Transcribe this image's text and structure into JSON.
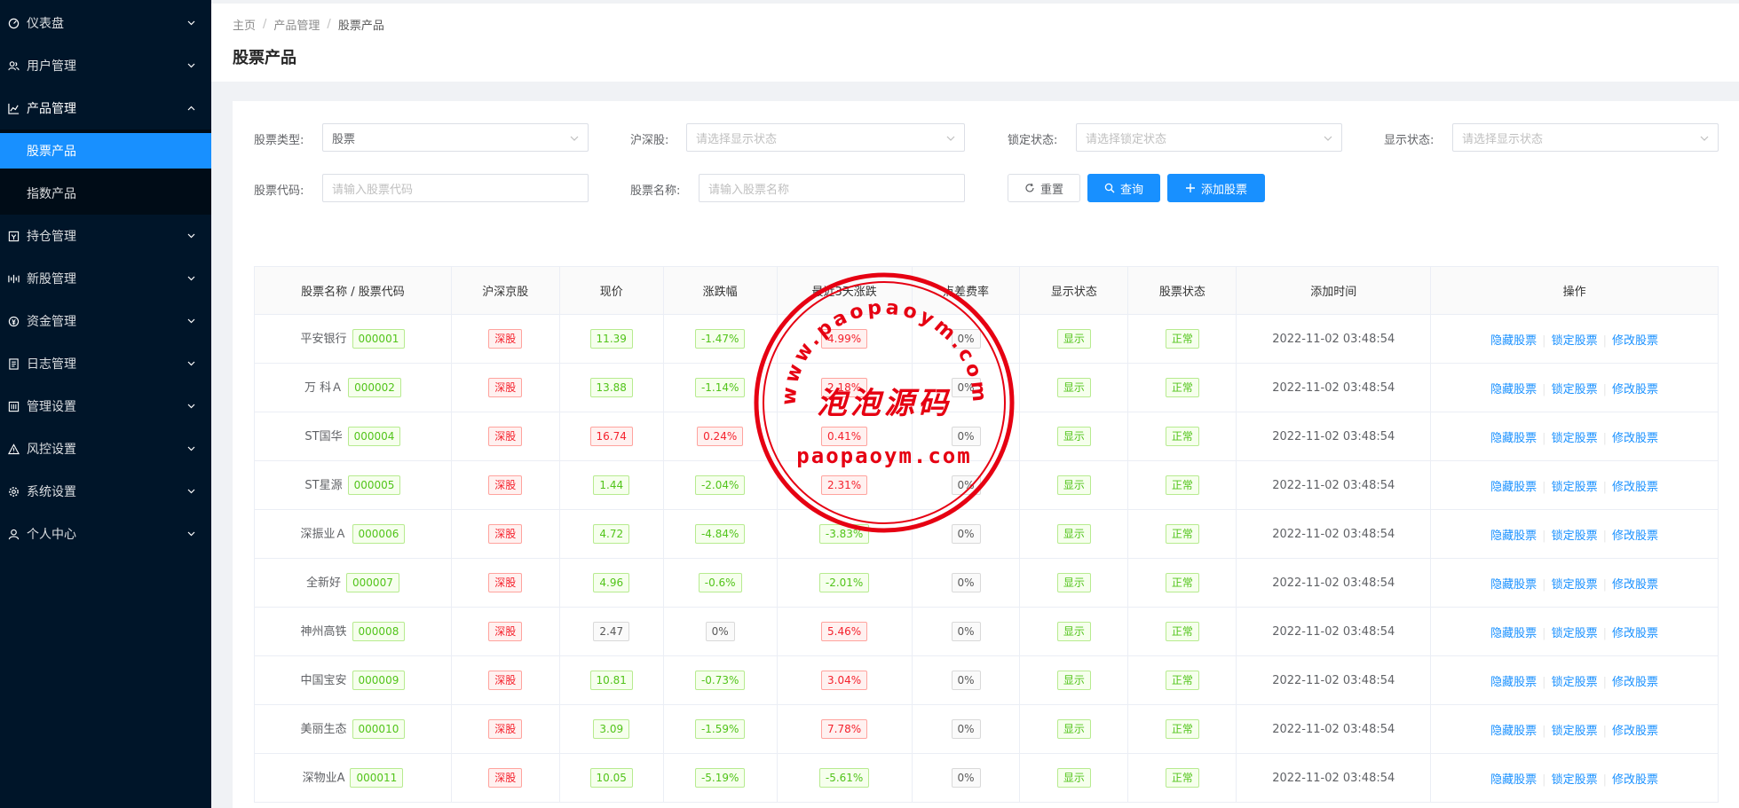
{
  "sidebar": {
    "items": [
      {
        "label": "仪表盘",
        "icon": "dashboard-icon"
      },
      {
        "label": "用户管理",
        "icon": "user-group-icon"
      },
      {
        "label": "产品管理",
        "icon": "chart-icon"
      },
      {
        "label": "持仓管理",
        "icon": "position-icon"
      },
      {
        "label": "新股管理",
        "icon": "ipo-icon"
      },
      {
        "label": "资金管理",
        "icon": "money-icon"
      },
      {
        "label": "日志管理",
        "icon": "log-icon"
      },
      {
        "label": "管理设置",
        "icon": "admin-settings-icon"
      },
      {
        "label": "风控设置",
        "icon": "warning-icon"
      },
      {
        "label": "系统设置",
        "icon": "gear-icon"
      },
      {
        "label": "个人中心",
        "icon": "person-icon"
      }
    ],
    "sub_items": [
      {
        "label": "股票产品"
      },
      {
        "label": "指数产品"
      }
    ]
  },
  "breadcrumb": {
    "home": "主页",
    "parent": "产品管理",
    "current": "股票产品"
  },
  "page_title": "股票产品",
  "filters": {
    "stock_type_label": "股票类型:",
    "stock_type_value": "股票",
    "market_label": "沪深股:",
    "market_placeholder": "请选择显示状态",
    "lock_label": "锁定状态:",
    "lock_placeholder": "请选择锁定状态",
    "display_label": "显示状态:",
    "display_placeholder": "请选择显示状态",
    "code_label": "股票代码:",
    "code_placeholder": "请输入股票代码",
    "name_label": "股票名称:",
    "name_placeholder": "请输入股票名称"
  },
  "buttons": {
    "reset": "重置",
    "search": "查询",
    "add": "添加股票"
  },
  "table": {
    "headers": [
      "股票名称 / 股票代码",
      "沪深京股",
      "现价",
      "涨跌幅",
      "最近3天涨跌",
      "点差费率",
      "显示状态",
      "股票状态",
      "添加时间",
      "操作"
    ],
    "actions": [
      "隐藏股票",
      "锁定股票",
      "修改股票"
    ],
    "rows": [
      {
        "name": "平安银行",
        "code": "000001",
        "market": "深股",
        "price": "11.39",
        "price_color": "green",
        "change": "-1.47%",
        "change_color": "green",
        "change3": "4.99%",
        "change3_color": "red",
        "spread": "0%",
        "display": "显示",
        "status": "正常",
        "time": "2022-11-02 03:48:54"
      },
      {
        "name": "万 科Ａ",
        "code": "000002",
        "market": "深股",
        "price": "13.88",
        "price_color": "green",
        "change": "-1.14%",
        "change_color": "green",
        "change3": "2.18%",
        "change3_color": "red",
        "spread": "0%",
        "display": "显示",
        "status": "正常",
        "time": "2022-11-02 03:48:54"
      },
      {
        "name": "ST国华",
        "code": "000004",
        "market": "深股",
        "price": "16.74",
        "price_color": "red",
        "change": "0.24%",
        "change_color": "red",
        "change3": "0.41%",
        "change3_color": "red",
        "spread": "0%",
        "display": "显示",
        "status": "正常",
        "time": "2022-11-02 03:48:54"
      },
      {
        "name": "ST星源",
        "code": "000005",
        "market": "深股",
        "price": "1.44",
        "price_color": "green",
        "change": "-2.04%",
        "change_color": "green",
        "change3": "2.31%",
        "change3_color": "red",
        "spread": "0%",
        "display": "显示",
        "status": "正常",
        "time": "2022-11-02 03:48:54"
      },
      {
        "name": "深振业Ａ",
        "code": "000006",
        "market": "深股",
        "price": "4.72",
        "price_color": "green",
        "change": "-4.84%",
        "change_color": "green",
        "change3": "-3.83%",
        "change3_color": "green",
        "spread": "0%",
        "display": "显示",
        "status": "正常",
        "time": "2022-11-02 03:48:54"
      },
      {
        "name": "全新好",
        "code": "000007",
        "market": "深股",
        "price": "4.96",
        "price_color": "green",
        "change": "-0.6%",
        "change_color": "green",
        "change3": "-2.01%",
        "change3_color": "green",
        "spread": "0%",
        "display": "显示",
        "status": "正常",
        "time": "2022-11-02 03:48:54"
      },
      {
        "name": "神州高铁",
        "code": "000008",
        "market": "深股",
        "price": "2.47",
        "price_color": "gray",
        "change": "0%",
        "change_color": "gray",
        "change3": "5.46%",
        "change3_color": "red",
        "spread": "0%",
        "display": "显示",
        "status": "正常",
        "time": "2022-11-02 03:48:54"
      },
      {
        "name": "中国宝安",
        "code": "000009",
        "market": "深股",
        "price": "10.81",
        "price_color": "green",
        "change": "-0.73%",
        "change_color": "green",
        "change3": "3.04%",
        "change3_color": "red",
        "spread": "0%",
        "display": "显示",
        "status": "正常",
        "time": "2022-11-02 03:48:54"
      },
      {
        "name": "美丽生态",
        "code": "000010",
        "market": "深股",
        "price": "3.09",
        "price_color": "green",
        "change": "-1.59%",
        "change_color": "green",
        "change3": "7.78%",
        "change3_color": "red",
        "spread": "0%",
        "display": "显示",
        "status": "正常",
        "time": "2022-11-02 03:48:54"
      },
      {
        "name": "深物业A",
        "code": "000011",
        "market": "深股",
        "price": "10.05",
        "price_color": "green",
        "change": "-5.19%",
        "change_color": "green",
        "change3": "-5.61%",
        "change3_color": "green",
        "spread": "0%",
        "display": "显示",
        "status": "正常",
        "time": "2022-11-02 03:48:54"
      }
    ]
  },
  "watermark": {
    "top_text": "www.paopaoym.com",
    "center_text": "泡泡源码",
    "bottom_text": "paopaoym.com",
    "color": "#e60012"
  },
  "colors": {
    "sidebar_bg": "#001529",
    "active": "#1890ff"
  }
}
